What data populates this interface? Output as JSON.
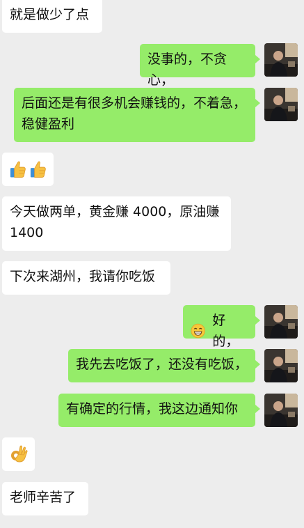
{
  "messages": [
    {
      "side": "left",
      "text": "就是做少了点"
    },
    {
      "side": "right",
      "text": "没事的，不贪心，"
    },
    {
      "side": "right",
      "text": "后面还是有很多机会赚钱的，不着急，稳健盈利"
    },
    {
      "side": "left",
      "emoji": "thumbs-up-icon x2"
    },
    {
      "side": "left",
      "text": "今天做两单，黄金赚 4000，原油赚 1400"
    },
    {
      "side": "left",
      "text": "下次来湖州，我请你吃饭"
    },
    {
      "side": "right",
      "emoji": "grinning-face-icon",
      "text": "好的，"
    },
    {
      "side": "right",
      "text": "我先去吃饭了，还没有吃饭，"
    },
    {
      "side": "right",
      "text": "有确定的行情，我这边通知你"
    },
    {
      "side": "left",
      "emoji": "ok-hand-icon"
    },
    {
      "side": "left",
      "text": "老师辛苦了"
    }
  ],
  "colors": {
    "background": "#ededed",
    "sent_bubble": "#95ec69",
    "received_bubble": "#ffffff"
  }
}
